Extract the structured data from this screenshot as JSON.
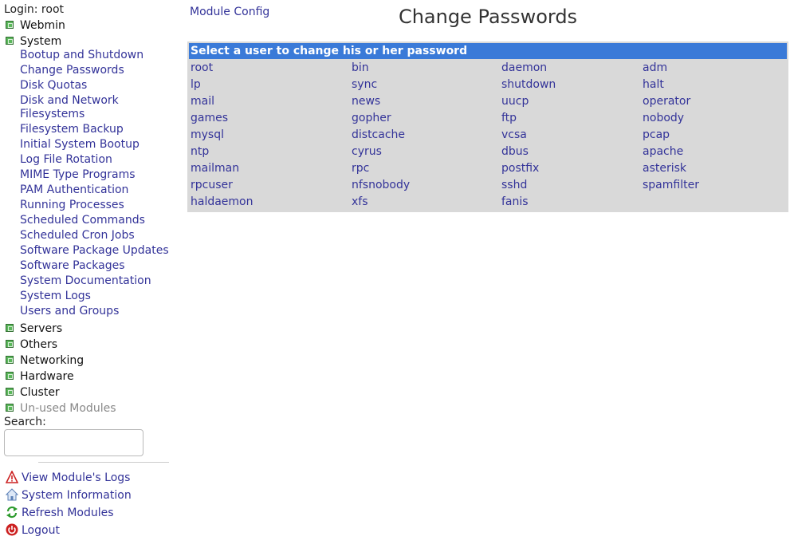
{
  "left": {
    "login": "Login: root",
    "categories": {
      "webmin": "Webmin",
      "system": "System",
      "servers": "Servers",
      "others": "Others",
      "networking": "Networking",
      "hardware": "Hardware",
      "cluster": "Cluster",
      "unused": "Un-used Modules"
    },
    "system_modules": [
      "Bootup and Shutdown",
      "Change Passwords",
      "Disk Quotas",
      "Disk and Network Filesystems",
      "Filesystem Backup",
      "Initial System Bootup",
      "Log File Rotation",
      "MIME Type Programs",
      "PAM Authentication",
      "Running Processes",
      "Scheduled Commands",
      "Scheduled Cron Jobs",
      "Software Package Updates",
      "Software Packages",
      "System Documentation",
      "System Logs",
      "Users and Groups"
    ],
    "search_label": "Search:",
    "search_value": "",
    "actions": {
      "view_logs": "View Module's Logs",
      "system_info": "System Information",
      "refresh": "Refresh Modules",
      "logout": "Logout"
    }
  },
  "main": {
    "module_config": "Module Config",
    "title": "Change Passwords",
    "panel_header": "Select a user to change his or her password",
    "users": [
      [
        "root",
        "bin",
        "daemon",
        "adm"
      ],
      [
        "lp",
        "sync",
        "shutdown",
        "halt"
      ],
      [
        "mail",
        "news",
        "uucp",
        "operator"
      ],
      [
        "games",
        "gopher",
        "ftp",
        "nobody"
      ],
      [
        "mysql",
        "distcache",
        "vcsa",
        "pcap"
      ],
      [
        "ntp",
        "cyrus",
        "dbus",
        "apache"
      ],
      [
        "mailman",
        "rpc",
        "postfix",
        "asterisk"
      ],
      [
        "rpcuser",
        "nfsnobody",
        "sshd",
        "spamfilter"
      ],
      [
        "haldaemon",
        "xfs",
        "fanis",
        ""
      ]
    ]
  },
  "colors": {
    "link": "#333399",
    "header_bg": "#3a7ad8",
    "panel_bg": "#d9d9d9",
    "category_icon": "#5cb85c"
  }
}
